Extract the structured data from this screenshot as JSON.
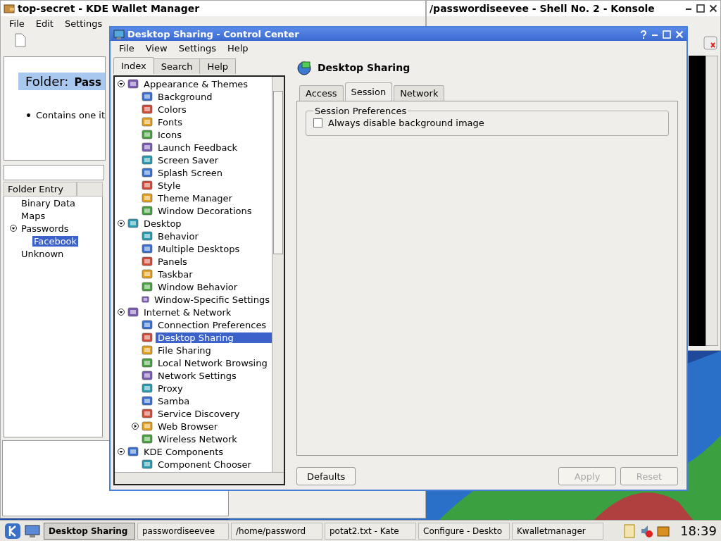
{
  "wallet_window": {
    "title": "top-secret - KDE Wallet Manager",
    "menu": [
      "File",
      "Edit",
      "Settings"
    ],
    "folder_label": "Folder:",
    "folder_name": "Pass",
    "summary": "Contains one it",
    "columns": [
      "Folder Entry"
    ],
    "tree": [
      {
        "label": "Binary Data",
        "selected": false
      },
      {
        "label": "Maps",
        "selected": false
      },
      {
        "label": "Passwords",
        "selected": false,
        "expanded": true,
        "children": [
          {
            "label": "Facebook",
            "selected": true
          }
        ]
      },
      {
        "label": "Unknown",
        "selected": false
      }
    ]
  },
  "konsole_window": {
    "title": "/passwordiseevee - Shell No. 2 - Konsole"
  },
  "control_center": {
    "title": "Desktop Sharing - Control Center",
    "menu": [
      "File",
      "View",
      "Settings",
      "Help"
    ],
    "tabs": [
      {
        "label": "Index",
        "selected": true
      },
      {
        "label": "Search",
        "selected": false
      },
      {
        "label": "Help",
        "selected": false
      }
    ],
    "tree": [
      {
        "label": "Appearance & Themes",
        "selected": false,
        "expanded": true,
        "children": [
          {
            "label": "Background",
            "selected": false
          },
          {
            "label": "Colors",
            "selected": false
          },
          {
            "label": "Fonts",
            "selected": false
          },
          {
            "label": "Icons",
            "selected": false
          },
          {
            "label": "Launch Feedback",
            "selected": false
          },
          {
            "label": "Screen Saver",
            "selected": false
          },
          {
            "label": "Splash Screen",
            "selected": false
          },
          {
            "label": "Style",
            "selected": false
          },
          {
            "label": "Theme Manager",
            "selected": false
          },
          {
            "label": "Window Decorations",
            "selected": false
          }
        ]
      },
      {
        "label": "Desktop",
        "selected": false,
        "expanded": true,
        "children": [
          {
            "label": "Behavior",
            "selected": false
          },
          {
            "label": "Multiple Desktops",
            "selected": false
          },
          {
            "label": "Panels",
            "selected": false
          },
          {
            "label": "Taskbar",
            "selected": false
          },
          {
            "label": "Window Behavior",
            "selected": false
          },
          {
            "label": "Window-Specific Settings",
            "selected": false
          }
        ]
      },
      {
        "label": "Internet & Network",
        "selected": false,
        "expanded": true,
        "children": [
          {
            "label": "Connection Preferences",
            "selected": false
          },
          {
            "label": "Desktop Sharing",
            "selected": true
          },
          {
            "label": "File Sharing",
            "selected": false
          },
          {
            "label": "Local Network Browsing",
            "selected": false
          },
          {
            "label": "Network Settings",
            "selected": false
          },
          {
            "label": "Proxy",
            "selected": false
          },
          {
            "label": "Samba",
            "selected": false
          },
          {
            "label": "Service Discovery",
            "selected": false
          },
          {
            "label": "Web Browser",
            "selected": false,
            "expanded": false
          },
          {
            "label": "Wireless Network",
            "selected": false
          }
        ]
      },
      {
        "label": "KDE Components",
        "selected": false,
        "expanded": true,
        "children": [
          {
            "label": "Component Chooser",
            "selected": false
          }
        ]
      }
    ],
    "module_title": "Desktop Sharing",
    "module_tabs": [
      {
        "label": "Access",
        "selected": false
      },
      {
        "label": "Session",
        "selected": true
      },
      {
        "label": "Network",
        "selected": false
      }
    ],
    "group_title": "Session Preferences",
    "options": [
      {
        "label": "Always disable background image",
        "checked": false
      }
    ],
    "buttons": [
      {
        "label": "Defaults",
        "disabled": false
      },
      {
        "label": "Apply",
        "disabled": true
      },
      {
        "label": "Reset",
        "disabled": true
      }
    ]
  },
  "taskbar": {
    "tasks": [
      {
        "label": "Desktop Sharing",
        "selected": true
      },
      {
        "label": "passwordiseevee",
        "selected": false
      },
      {
        "label": "/home/password",
        "selected": false
      },
      {
        "label": "potat2.txt - Kate",
        "selected": false
      },
      {
        "label": "Configure - Deskto",
        "selected": false
      },
      {
        "label": "Kwalletmanager",
        "selected": false
      }
    ],
    "clock": "18:39"
  }
}
